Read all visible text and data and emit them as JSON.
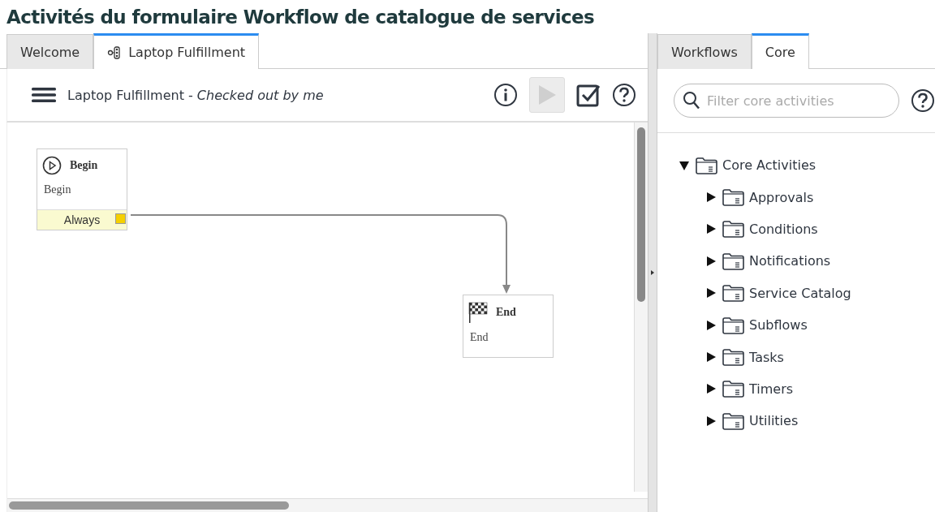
{
  "page_title": "Activités du formulaire Workflow de catalogue de services",
  "editor": {
    "tabs": [
      {
        "label": "Welcome",
        "selected": false,
        "kind": "plain"
      },
      {
        "label": "Laptop Fulfillment",
        "selected": true,
        "kind": "workflow"
      }
    ],
    "toolbar": {
      "workflow_name": "Laptop Fulfillment",
      "status": "- *Checked out by me*",
      "run_disabled": true
    },
    "nodes": [
      {
        "kind": "begin",
        "title": "Begin",
        "subtitle": "Begin",
        "exit_label": "Always"
      },
      {
        "kind": "end",
        "title": "End",
        "subtitle": "End"
      }
    ]
  },
  "palette": {
    "tabs": [
      {
        "label": "Workflows",
        "selected": false
      },
      {
        "label": "Core",
        "selected": true
      }
    ],
    "search": {
      "placeholder": "Filter core activities"
    },
    "tree": [
      {
        "label": "Core Activities",
        "expanded": true,
        "children": [
          {
            "label": "Approvals",
            "expanded": false
          },
          {
            "label": "Conditions",
            "expanded": false
          },
          {
            "label": "Notifications",
            "expanded": false
          },
          {
            "label": "Service Catalog",
            "expanded": false
          },
          {
            "label": "Subflows",
            "expanded": false
          },
          {
            "label": "Tasks",
            "expanded": false
          },
          {
            "label": "Timers",
            "expanded": false
          },
          {
            "label": "Utilities",
            "expanded": false
          }
        ]
      }
    ]
  }
}
